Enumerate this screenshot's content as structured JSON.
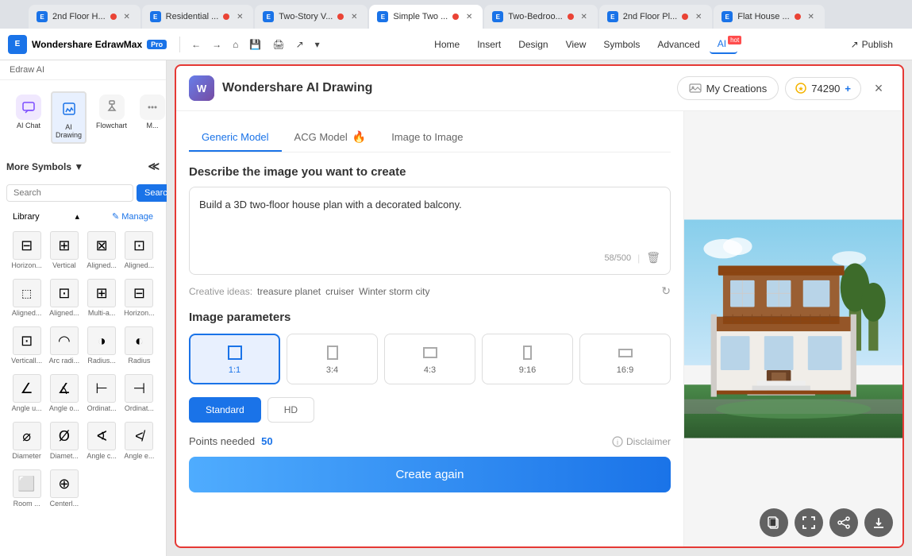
{
  "app": {
    "name": "Wondershare EdrawMax",
    "badge": "Pro"
  },
  "tabs": [
    {
      "id": "tab1",
      "label": "2nd Floor H...",
      "active": false,
      "dot": true
    },
    {
      "id": "tab2",
      "label": "Residential ...",
      "active": false,
      "dot": true
    },
    {
      "id": "tab3",
      "label": "Two-Story V...",
      "active": false,
      "dot": true
    },
    {
      "id": "tab4",
      "label": "Simple Two ...",
      "active": true,
      "dot": true
    },
    {
      "id": "tab5",
      "label": "Two-Bedroo...",
      "active": false,
      "dot": true
    },
    {
      "id": "tab6",
      "label": "2nd Floor Pl...",
      "active": false,
      "dot": true
    },
    {
      "id": "tab7",
      "label": "Flat House ...",
      "active": false,
      "dot": true
    }
  ],
  "menu": {
    "items": [
      "Home",
      "Insert",
      "Design",
      "View",
      "Symbols",
      "Advanced",
      "AI"
    ],
    "active": "AI",
    "ai_hot": "hot",
    "publish_label": "Publish"
  },
  "sidebar": {
    "edraw_ai_label": "Edraw AI",
    "more_symbols": "More Symbols ▼",
    "search_placeholder": "Search",
    "search_btn": "Search",
    "library_label": "Library",
    "manage_label": "✎ Manage",
    "icons": [
      {
        "id": "ai-chat",
        "label": "AI Chat"
      },
      {
        "id": "ai-drawing",
        "label": "AI Drawing",
        "active": true
      },
      {
        "id": "flowchart",
        "label": "Flowchart"
      },
      {
        "id": "more",
        "label": "M..."
      }
    ],
    "symbols": [
      {
        "label": "Horizon...",
        "icon": "⊟"
      },
      {
        "label": "Vertical",
        "icon": "⊞"
      },
      {
        "label": "Aligned...",
        "icon": "⊠"
      },
      {
        "label": "Aligned...",
        "icon": "⊡"
      },
      {
        "label": "Aligned...",
        "icon": "⬚"
      },
      {
        "label": "Aligned...",
        "icon": "⬛"
      },
      {
        "label": "Multi-a...",
        "icon": "⊞"
      },
      {
        "label": "Horizon...",
        "icon": "⊟"
      },
      {
        "label": "Verticall...",
        "icon": "⊡"
      },
      {
        "label": "Arc radi...",
        "icon": "◠"
      },
      {
        "label": "Radius...",
        "icon": "◑"
      },
      {
        "label": "Radius",
        "icon": "◐"
      },
      {
        "label": "Angle u...",
        "icon": "∠"
      },
      {
        "label": "Angle o...",
        "icon": "∡"
      },
      {
        "label": "Ordinat...",
        "icon": "⊢"
      },
      {
        "label": "Ordinat...",
        "icon": "⊣"
      },
      {
        "label": "Diameter",
        "icon": "⌀"
      },
      {
        "label": "Diamet...",
        "icon": "Ø"
      },
      {
        "label": "Angle c...",
        "icon": "∢"
      },
      {
        "label": "Angle e...",
        "icon": "≮"
      },
      {
        "label": "Room ...",
        "icon": "⬜"
      },
      {
        "label": "Centerl...",
        "icon": "⊕"
      }
    ]
  },
  "modal": {
    "title": "Wondershare AI Drawing",
    "logo_text": "W",
    "my_creations_label": "My Creations",
    "points_value": "74290",
    "plus_label": "+",
    "close_label": "×",
    "tabs": [
      {
        "id": "generic",
        "label": "Generic Model",
        "active": true
      },
      {
        "id": "acg",
        "label": "ACG Model",
        "has_fire": true
      },
      {
        "id": "image",
        "label": "Image to Image"
      }
    ],
    "prompt_section": {
      "title": "Describe the image you want to create",
      "text": "Build a 3D two-floor house plan with a decorated balcony.",
      "char_count": "58/500"
    },
    "creative_ideas": {
      "label": "Creative ideas:",
      "items": [
        "treasure planet",
        "cruiser",
        "Winter storm city"
      ]
    },
    "params_section": {
      "title": "Image parameters",
      "ratios": [
        {
          "id": "1:1",
          "label": "1:1",
          "active": true
        },
        {
          "id": "3:4",
          "label": "3:4",
          "active": false
        },
        {
          "id": "4:3",
          "label": "4:3",
          "active": false
        },
        {
          "id": "9:16",
          "label": "9:16",
          "active": false
        },
        {
          "id": "16:9",
          "label": "16:9",
          "active": false
        }
      ]
    },
    "points_label": "Points needed",
    "points_count": "50",
    "disclaimer_label": "Disclaimer",
    "create_again_label": "Create again"
  }
}
